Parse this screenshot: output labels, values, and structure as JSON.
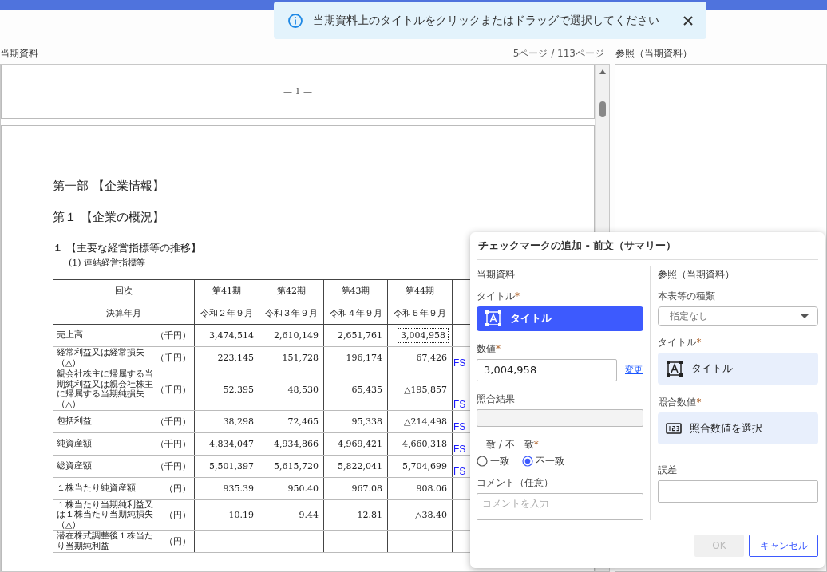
{
  "toast": {
    "message": "当期資料上のタイトルをクリックまたはドラッグで選択してください"
  },
  "left_panel": {
    "title": "当期資料",
    "page_indicator": "5ページ / 113ページ"
  },
  "right_panel": {
    "title": "参照（当期資料）"
  },
  "document": {
    "page_number": "— 1 —",
    "headings": [
      {
        "kind": "part",
        "text": "第一部 【企業情報】"
      },
      {
        "kind": "chapter",
        "text": "第１ 【企業の概況】"
      },
      {
        "kind": "section",
        "text": "１ 【主要な経営指標等の推移】"
      },
      {
        "kind": "sub",
        "text": "(1) 連結経営指標等"
      }
    ],
    "table": {
      "rows": [
        {
          "kind": "head",
          "label": "回次",
          "values": [
            {
              "text": "第41期",
              "selected": false
            },
            {
              "text": "第42期",
              "selected": false
            },
            {
              "text": "第43期",
              "selected": false
            },
            {
              "text": "第44期",
              "selected": false
            }
          ]
        },
        {
          "kind": "head",
          "label": "決算年月",
          "values": [
            {
              "text": "令和２年９月",
              "selected": false
            },
            {
              "text": "令和３年９月",
              "selected": false
            },
            {
              "text": "令和４年９月",
              "selected": false
            },
            {
              "text": "令和５年９月",
              "selected": false
            }
          ]
        },
        {
          "kind": "data",
          "label": "売上高",
          "unit": "（千円）",
          "values": [
            {
              "text": "3,474,514",
              "selected": false
            },
            {
              "text": "2,610,149",
              "selected": false
            },
            {
              "text": "2,651,761",
              "selected": false
            },
            {
              "text": "3,004,958",
              "selected": true
            }
          ]
        },
        {
          "kind": "data",
          "label": "経常利益又は経常損失（△）",
          "unit": "（千円）",
          "marker": "FS",
          "values": [
            {
              "text": "223,145",
              "selected": false
            },
            {
              "text": "151,728",
              "selected": false
            },
            {
              "text": "196,174",
              "selected": false
            },
            {
              "text": "67,426",
              "selected": false
            }
          ]
        },
        {
          "kind": "data",
          "label": "親会社株主に帰属する当期純利益又は親会社株主に帰属する当期純損失（△）",
          "unit": "（千円）",
          "marker": "FS",
          "values": [
            {
              "text": "52,395",
              "selected": false
            },
            {
              "text": "48,530",
              "selected": false
            },
            {
              "text": "65,435",
              "selected": false
            },
            {
              "text": "△195,857",
              "selected": false
            }
          ]
        },
        {
          "kind": "data",
          "label": "包括利益",
          "unit": "（千円）",
          "marker": "FS",
          "values": [
            {
              "text": "38,298",
              "selected": false
            },
            {
              "text": "72,465",
              "selected": false
            },
            {
              "text": "95,338",
              "selected": false
            },
            {
              "text": "△214,498",
              "selected": false
            }
          ]
        },
        {
          "kind": "data",
          "label": "純資産額",
          "unit": "（千円）",
          "marker": "FS",
          "values": [
            {
              "text": "4,834,047",
              "selected": false
            },
            {
              "text": "4,934,866",
              "selected": false
            },
            {
              "text": "4,969,421",
              "selected": false
            },
            {
              "text": "4,660,318",
              "selected": false
            }
          ]
        },
        {
          "kind": "data",
          "label": "総資産額",
          "unit": "（千円）",
          "marker": "FS",
          "values": [
            {
              "text": "5,501,397",
              "selected": false
            },
            {
              "text": "5,615,720",
              "selected": false
            },
            {
              "text": "5,822,041",
              "selected": false
            },
            {
              "text": "5,704,699",
              "selected": false
            }
          ]
        },
        {
          "kind": "data",
          "label": "１株当たり純資産額",
          "unit": "（円）",
          "values": [
            {
              "text": "935.39",
              "selected": false
            },
            {
              "text": "950.40",
              "selected": false
            },
            {
              "text": "967.08",
              "selected": false
            },
            {
              "text": "908.06",
              "selected": false
            }
          ]
        },
        {
          "kind": "data",
          "label": "１株当たり当期純利益又は１株当たり当期純損失（△）",
          "unit": "（円）",
          "values": [
            {
              "text": "10.19",
              "selected": false
            },
            {
              "text": "9.44",
              "selected": false
            },
            {
              "text": "12.81",
              "selected": false
            },
            {
              "text": "△38.40",
              "selected": false
            }
          ]
        },
        {
          "kind": "data",
          "label": "潜在株式調整後１株当たり当期純利益",
          "unit": "（円）",
          "values": [
            {
              "text": "—",
              "selected": false
            },
            {
              "text": "—",
              "selected": false
            },
            {
              "text": "—",
              "selected": false
            },
            {
              "text": "—",
              "selected": false
            }
          ]
        }
      ]
    }
  },
  "dialog": {
    "title": "チェックマークの追加 - 前文（サマリー）",
    "left": {
      "heading": "当期資料",
      "title_field": {
        "label": "タイトル",
        "required_mark": "*",
        "value": "タイトル",
        "selected": true
      },
      "number_field": {
        "label": "数値",
        "required_mark": "*",
        "value": "3,004,958",
        "link": "変更"
      },
      "result_field": {
        "label": "照合結果",
        "disabled": true
      },
      "match": {
        "label": "一致 / 不一致",
        "required_mark": "*",
        "options": [
          {
            "label": "一致",
            "selected": false
          },
          {
            "label": "不一致",
            "selected": true
          }
        ]
      },
      "comment": {
        "label": "コメント（任意）",
        "placeholder": "コメントを入力"
      }
    },
    "right": {
      "heading": "参照（当期資料）",
      "type_select": {
        "label": "本表等の種類",
        "value": "指定なし"
      },
      "title_field": {
        "label": "タイトル",
        "required_mark": "*",
        "value": "タイトル",
        "selected": false
      },
      "match_value": {
        "label": "照合数値",
        "required_mark": "*",
        "value": "照合数値を選択"
      },
      "error_field": {
        "label": "誤差"
      }
    },
    "buttons": [
      {
        "label": "OK",
        "kind": "primary",
        "disabled": true
      },
      {
        "label": "キャンセル",
        "kind": "outline",
        "disabled": false
      }
    ]
  }
}
